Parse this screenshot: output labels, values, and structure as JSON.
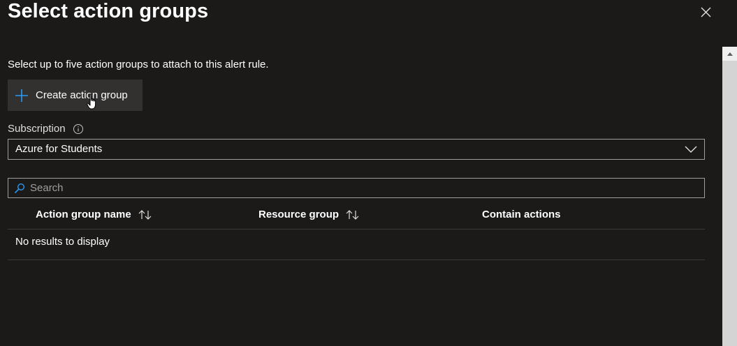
{
  "panel": {
    "title": "Select action groups",
    "description": "Select up to five action groups to attach to this alert rule."
  },
  "toolbar": {
    "create_label": "Create action group",
    "create_icon": "plus-icon"
  },
  "subscription": {
    "label": "Subscription",
    "info_icon": "info-icon",
    "selected": "Azure for Students"
  },
  "search": {
    "placeholder": "Search",
    "value": ""
  },
  "table": {
    "columns": [
      {
        "label": "Action group name",
        "sortable": true
      },
      {
        "label": "Resource group",
        "sortable": true
      },
      {
        "label": "Contain actions",
        "sortable": false
      }
    ],
    "empty_message": "No results to display"
  },
  "colors": {
    "background": "#1b1a19",
    "button_bg": "#323130",
    "accent": "#2899f5",
    "border": "#a19f9d"
  }
}
